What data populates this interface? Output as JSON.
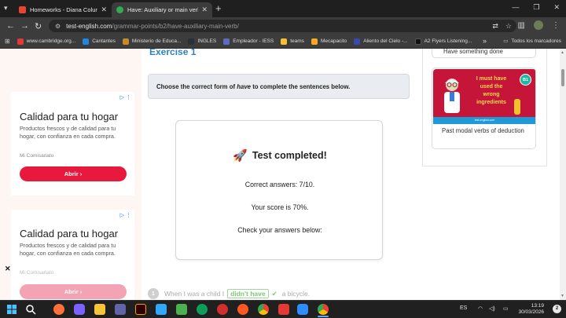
{
  "browser": {
    "tabs": [
      {
        "title": "Homeworks - Diana Columbo",
        "active": false,
        "favicon_color": "#ea4335"
      },
      {
        "title": "Have: Auxiliary or main verb - T",
        "active": true,
        "favicon_color": "#34a853"
      }
    ],
    "url_host": "test-english.com",
    "url_path": "/grammar-points/b2/have-auxiliary-main-verb/",
    "bookmarks": [
      {
        "label": "www.cambridge.org...",
        "color": "#e53935"
      },
      {
        "label": "Cantantes",
        "color": "#1e88e5"
      },
      {
        "label": "Ministerio de Educa...",
        "color": "#c58b2a"
      },
      {
        "label": "INGLES",
        "color": "#263238"
      },
      {
        "label": "Empleador - IESS",
        "color": "#5c6bc0"
      },
      {
        "label": "teams",
        "color": "#fbc02d"
      },
      {
        "label": "Mecapacito",
        "color": "#f9a825"
      },
      {
        "label": "Aliento del Cielo -...",
        "color": "#3949ab"
      },
      {
        "label": "A2 Flyers Listening...",
        "color": "#111111"
      }
    ],
    "all_bookmarks_label": "Todos los marcadores"
  },
  "ads": [
    {
      "title": "Calidad para tu hogar",
      "text": "Productos frescos y de calidad para tu hogar, con confianza en cada compra.",
      "source": "Mi Comisariato",
      "button": "Abrir"
    },
    {
      "title": "Calidad para tu hogar",
      "text": "Productos frescos y de calidad para tu hogar, con confianza en cada compra.",
      "source": "Mi Comisariato",
      "button": "Abrir"
    }
  ],
  "main": {
    "exercise_title": "Exercise 1",
    "instruction_before": "Choose the correct form of ",
    "instruction_italic": "have",
    "instruction_after": " to complete the sentences below.",
    "result": {
      "title": "Test completed!",
      "correct": "Correct answers: 7/10.",
      "score": "Your score is 70%.",
      "check": "Check your answers below:"
    },
    "question1": {
      "number": "1",
      "before": "When I was a child I",
      "answer": "didn't have",
      "after": "a bicycle."
    }
  },
  "sidebar": {
    "top_item": "Have something done",
    "card": {
      "image_text": [
        "I must have",
        "used the",
        "wrong",
        "ingredients"
      ],
      "image_strip": "test-english.com",
      "badge": "B1",
      "caption": "Past modal verbs of deduction"
    }
  },
  "taskbar": {
    "language": "ES",
    "time": "13:19",
    "date": "30/03/2026",
    "notifications": "2",
    "apps": [
      {
        "name": "windows-start",
        "color": "#4cc2ff"
      },
      {
        "name": "search",
        "color": "#ffffff"
      },
      {
        "name": "firefox",
        "color": "#ff7139"
      },
      {
        "name": "copilot",
        "color": "#7b61ff"
      },
      {
        "name": "file-explorer",
        "color": "#f8c537"
      },
      {
        "name": "teams",
        "color": "#6264a7"
      },
      {
        "name": "illustrator",
        "color": "#ff9a00"
      },
      {
        "name": "photoshop",
        "color": "#31a8ff"
      },
      {
        "name": "notepad",
        "color": "#4caf50"
      },
      {
        "name": "edge",
        "color": "#0f9d58"
      },
      {
        "name": "gallery",
        "color": "#d32f2f"
      },
      {
        "name": "media-player",
        "color": "#ff5722"
      },
      {
        "name": "chrome",
        "color": "#4285f4"
      },
      {
        "name": "acrobat",
        "color": "#e53935"
      },
      {
        "name": "word",
        "color": "#2b579a"
      },
      {
        "name": "zoom",
        "color": "#2d8cff"
      },
      {
        "name": "chrome-active",
        "color": "#4285f4"
      }
    ]
  }
}
